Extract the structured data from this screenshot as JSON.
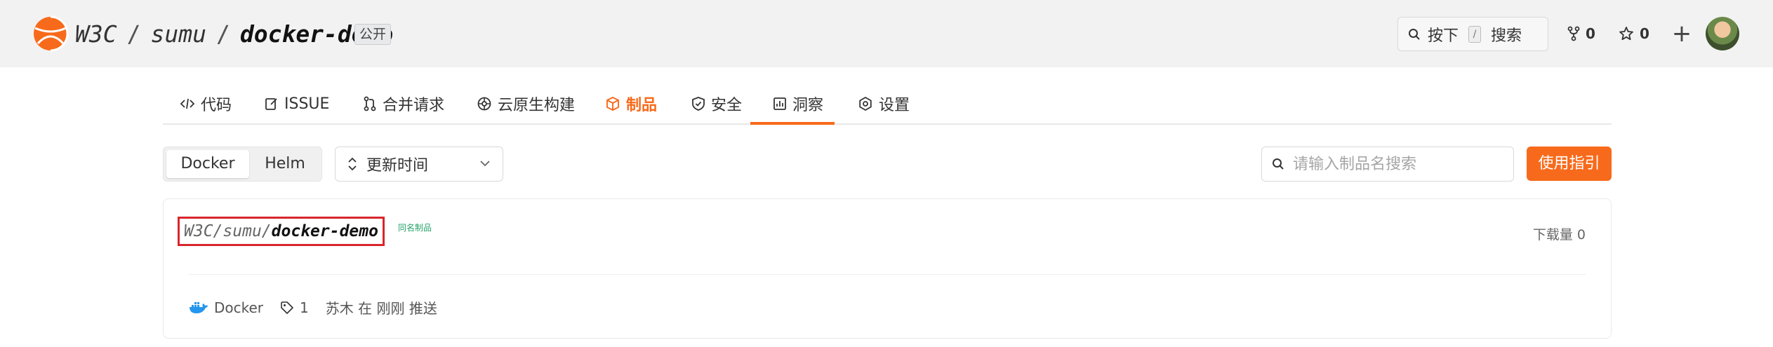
{
  "header": {
    "owner": "W3C",
    "group": "sumu",
    "repo": "docker-demo",
    "visibility": "公开",
    "search": {
      "press_label": "按下",
      "key": "/",
      "action_label": "搜索"
    },
    "forks": "0",
    "stars": "0"
  },
  "tabs": [
    {
      "label": "代码",
      "icon": "code-icon"
    },
    {
      "label": "ISSUE",
      "icon": "edit-icon"
    },
    {
      "label": "合并请求",
      "icon": "merge-icon"
    },
    {
      "label": "云原生构建",
      "icon": "build-icon"
    },
    {
      "label": "制品",
      "icon": "package-icon",
      "active": true
    },
    {
      "label": "安全",
      "icon": "shield-icon"
    },
    {
      "label": "洞察",
      "icon": "chart-icon"
    },
    {
      "label": "设置",
      "icon": "settings-icon"
    }
  ],
  "toolbar": {
    "segments": [
      "Docker",
      "Helm"
    ],
    "selected_segment": "Docker",
    "sort_label": "更新时间",
    "search_placeholder": "请输入制品名搜索",
    "guide_label": "使用指引"
  },
  "package": {
    "owner": "W3C",
    "group": "sumu",
    "name": "docker-demo",
    "badge": "同名制品",
    "downloads": "下载量 0",
    "type": "Docker",
    "tag_count": "1",
    "pushed_info": "苏木 在 刚刚 推送"
  },
  "colors": {
    "accent": "#f86a1b",
    "highlight_border": "#d9262c",
    "badge_green": "#27a36a",
    "docker_blue": "#2496ed"
  }
}
